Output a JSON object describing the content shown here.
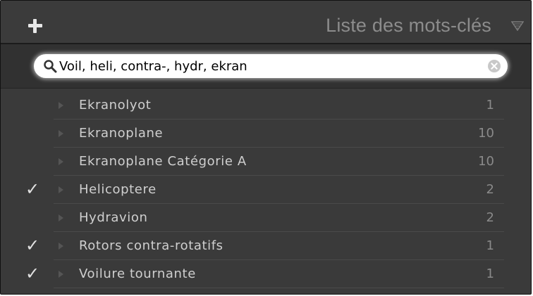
{
  "header": {
    "title": "Liste des mots-clés",
    "add_icon": "plus-icon",
    "collapse_icon": "triangle-down-icon"
  },
  "search": {
    "value": "Voil, heli, contra-, hydr, ekran",
    "icon": "search-icon",
    "clear_icon": "clear-icon"
  },
  "keywords": [
    {
      "label": "Ekranolyot",
      "count": "1",
      "checked": false
    },
    {
      "label": "Ekranoplane",
      "count": "10",
      "checked": false
    },
    {
      "label": "Ekranoplane Catégorie A",
      "count": "10",
      "checked": false
    },
    {
      "label": "Helicoptere",
      "count": "2",
      "checked": true
    },
    {
      "label": "Hydravion",
      "count": "2",
      "checked": false
    },
    {
      "label": "Rotors contra-rotatifs",
      "count": "1",
      "checked": true
    },
    {
      "label": "Voilure tournante",
      "count": "1",
      "checked": true
    }
  ],
  "colors": {
    "panel_bg": "#3a3a3a",
    "title_color": "#8c8c8c",
    "label_color": "#cfcfcf",
    "count_color": "#8a8a8a"
  }
}
